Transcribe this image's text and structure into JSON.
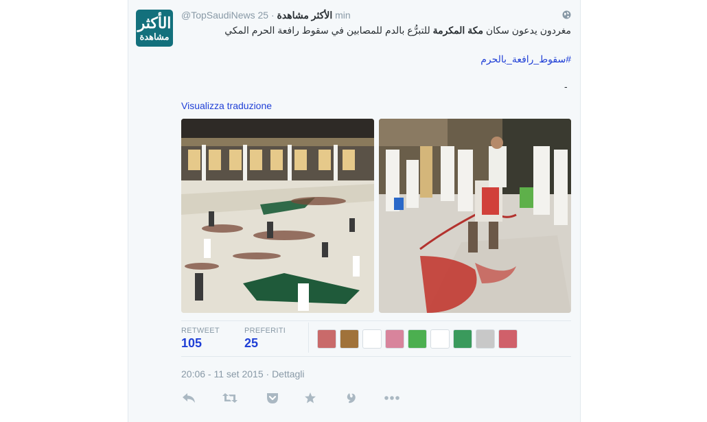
{
  "tweet": {
    "handle": "@TopSaudiNews",
    "name": "الأكثر مشاهدة",
    "separator": "·",
    "time": "25 min",
    "avatar_line1": "الأكثر",
    "avatar_line2": "مشاهدة",
    "text_part1": "مغردون يدعون سكان ",
    "text_bold": "مكة المكرمة",
    "text_part2": " للتبرُّع بالدم للمصابين في سقوط رافعة الحرم المكي",
    "hashtag": "#سقوط_رافعة_بالحرم",
    "trailing": "-",
    "translate_link": "Visualizza traduzione"
  },
  "stats": {
    "retweet_label": "RETWEET",
    "retweet_count": "105",
    "favorites_label": "PREFERITI",
    "favorites_count": "25"
  },
  "footer": {
    "timestamp": "20:06 - 11 set 2015",
    "dot": "·",
    "details_link": "Dettagli"
  },
  "favoriters": [
    {
      "name": "favoriter-avatar-1",
      "color": "#c96a6a"
    },
    {
      "name": "favoriter-avatar-2",
      "color": "#a0723a"
    },
    {
      "name": "favoriter-avatar-3",
      "color": "#ffffff"
    },
    {
      "name": "favoriter-avatar-4",
      "color": "#d8849c"
    },
    {
      "name": "favoriter-avatar-5",
      "color": "#4caf50"
    },
    {
      "name": "favoriter-avatar-6",
      "color": "#ffffff"
    },
    {
      "name": "favoriter-avatar-7",
      "color": "#3a9a5c"
    },
    {
      "name": "favoriter-avatar-8",
      "color": "#c8c8c8"
    },
    {
      "name": "favoriter-avatar-9",
      "color": "#d0606a"
    }
  ],
  "actions": [
    "reply-icon",
    "retweet-icon",
    "pocket-icon",
    "favorite-icon",
    "vine-icon",
    "more-icon"
  ],
  "colors": {
    "link": "#1f3fd6",
    "muted": "#8899a6",
    "avatar_bg": "#13707c"
  }
}
